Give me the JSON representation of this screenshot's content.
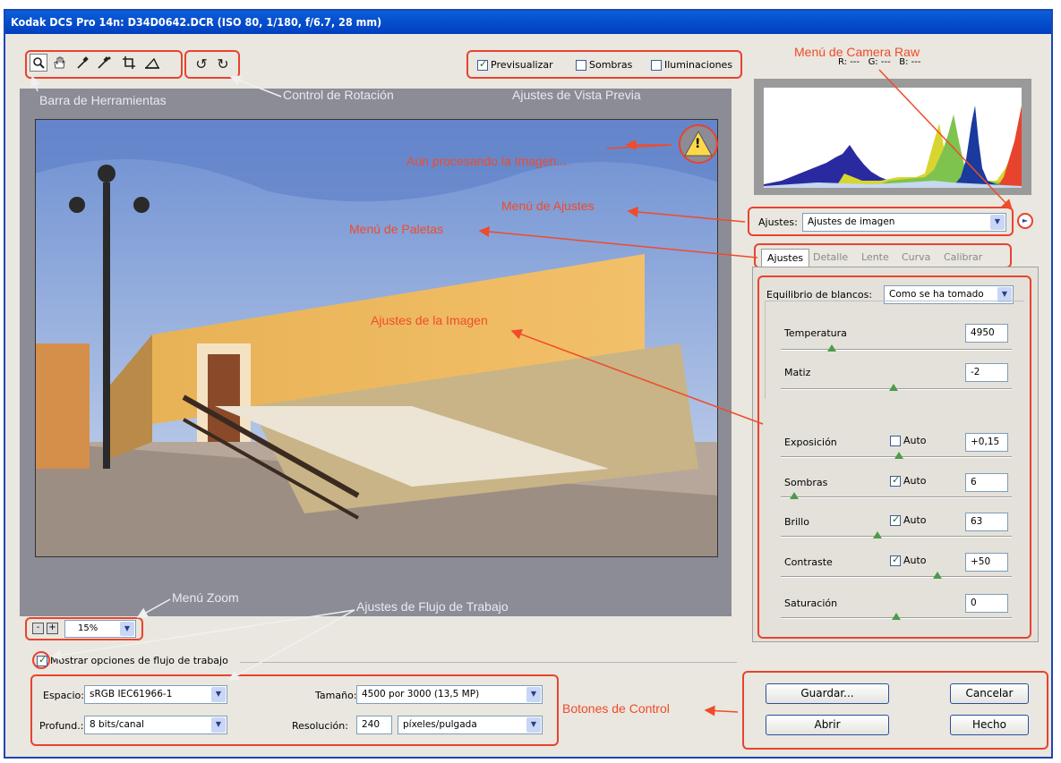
{
  "window": {
    "title": "Kodak DCS Pro 14n:  D34D0642.DCR  (ISO 80, 1/180, f/6.7, 28 mm)"
  },
  "toolbar": {
    "tools": [
      {
        "name": "zoom-tool-icon",
        "glyph": "🔍"
      },
      {
        "name": "hand-tool-icon",
        "glyph": "✋"
      },
      {
        "name": "white-balance-tool-icon",
        "glyph": "↗"
      },
      {
        "name": "color-sampler-tool-icon",
        "glyph": "↗"
      },
      {
        "name": "crop-tool-icon",
        "glyph": "⌗"
      },
      {
        "name": "straighten-tool-icon",
        "glyph": "△"
      }
    ],
    "rotate": [
      {
        "name": "rotate-left-icon",
        "glyph": "↺"
      },
      {
        "name": "rotate-right-icon",
        "glyph": "↻"
      }
    ]
  },
  "preview_options": {
    "previsualizar": "Previsualizar",
    "sombras": "Sombras",
    "iluminaciones": "Iluminaciones",
    "previsualizar_checked": true,
    "sombras_checked": false,
    "iluminaciones_checked": false
  },
  "rgb": {
    "r": "R: ---",
    "g": "G: ---",
    "b": "B: ---"
  },
  "annotations": {
    "camera_raw_menu": "Menú de Camera Raw",
    "toolbar": "Barra de Herramientas",
    "rotation": "Control de Rotación",
    "preview_settings": "Ajustes de Vista Previa",
    "processing": "Aún procesando la Imagen...",
    "settings_menu": "Menú de Ajustes",
    "palette_menu": "Menú de Paletas",
    "image_settings": "Ajustes de la Imagen",
    "zoom_menu": "Menú Zoom",
    "workflow_settings": "Ajustes de Flujo de Trabajo",
    "control_buttons": "Botones de Control"
  },
  "settings": {
    "label": "Ajustes:",
    "value": "Ajustes de imagen"
  },
  "tabs": [
    "Ajustes",
    "Detalle",
    "Lente",
    "Curva",
    "Calibrar"
  ],
  "white_balance": {
    "label": "Equilibrio de blancos:",
    "value": "Como se ha tomado"
  },
  "adjustments": {
    "temperatura": {
      "label": "Temperatura",
      "value": "4950",
      "level": 0.22
    },
    "matiz": {
      "label": "Matiz",
      "value": "-2",
      "level": 0.49
    },
    "exposicion": {
      "label": "Exposición",
      "value": "+0,15",
      "level": 0.51,
      "auto": false
    },
    "sombras": {
      "label": "Sombras",
      "value": "6",
      "level": 0.06,
      "auto": true
    },
    "brillo": {
      "label": "Brillo",
      "value": "63",
      "level": 0.42,
      "auto": true
    },
    "contraste": {
      "label": "Contraste",
      "value": "+50",
      "level": 0.68,
      "auto": true
    },
    "saturacion": {
      "label": "Saturación",
      "value": "0",
      "level": 0.5
    }
  },
  "auto_label": "Auto",
  "zoom": {
    "value": "15%",
    "minus": "-",
    "plus": "+"
  },
  "workflow": {
    "show_options": "Mostrar opciones de flujo de trabajo",
    "espacio_label": "Espacio:",
    "espacio_value": "sRGB IEC61966-1",
    "profund_label": "Profund.:",
    "profund_value": "8 bits/canal",
    "tamano_label": "Tamaño:",
    "tamano_value": "4500 por 3000  (13,5 MP)",
    "resolucion_label": "Resolución:",
    "resolucion_value": "240",
    "resolucion_unit": "píxeles/pulgada"
  },
  "buttons": {
    "guardar": "Guardar...",
    "cancelar": "Cancelar",
    "abrir": "Abrir",
    "hecho": "Hecho"
  },
  "warning_icon": "!",
  "colors": {
    "accent_red": "#e8432e",
    "title_blue": "#0a55d4"
  }
}
